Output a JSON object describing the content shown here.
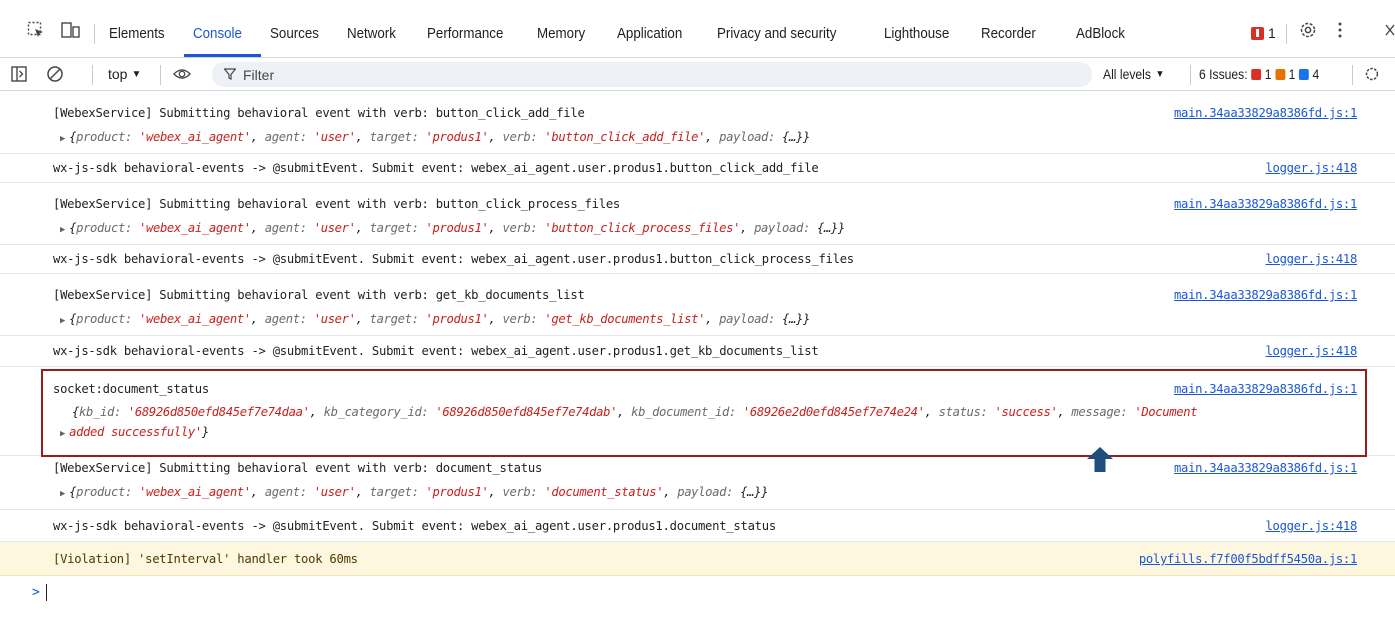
{
  "tabs": [
    {
      "label": "Elements"
    },
    {
      "label": "Console"
    },
    {
      "label": "Sources"
    },
    {
      "label": "Network"
    },
    {
      "label": "Performance"
    },
    {
      "label": "Memory"
    },
    {
      "label": "Application"
    },
    {
      "label": "Privacy and security"
    },
    {
      "label": "Lighthouse"
    },
    {
      "label": "Recorder"
    },
    {
      "label": "AdBlock"
    }
  ],
  "active_tab": "Console",
  "error_count": "1",
  "toolbar": {
    "context": "top",
    "filter_placeholder": "Filter",
    "levels": "All levels",
    "issues_label": "6 Issues:",
    "issues_errors": "1",
    "issues_warnings": "1",
    "issues_info": "4"
  },
  "messages": [
    {
      "text": "[WebexService] Submitting behavioral event with verb: button_click_add_file",
      "source": "main.34aa33829a8386fd.js:1",
      "object": {
        "product": "webex_ai_agent",
        "agent": "user",
        "target": "produs1",
        "verb": "button_click_add_file",
        "payload_text": "{…}"
      }
    },
    {
      "text": "wx-js-sdk behavioral-events ->  @submitEvent. Submit event: webex_ai_agent.user.produs1.button_click_add_file",
      "source": "logger.js:418"
    },
    {
      "text": "[WebexService] Submitting behavioral event with verb: button_click_process_files",
      "source": "main.34aa33829a8386fd.js:1",
      "object": {
        "product": "webex_ai_agent",
        "agent": "user",
        "target": "produs1",
        "verb": "button_click_process_files",
        "payload_text": "{…}"
      }
    },
    {
      "text": "wx-js-sdk behavioral-events ->  @submitEvent. Submit event: webex_ai_agent.user.produs1.button_click_process_files",
      "source": "logger.js:418"
    },
    {
      "text": "[WebexService] Submitting behavioral event with verb: get_kb_documents_list",
      "source": "main.34aa33829a8386fd.js:1",
      "object": {
        "product": "webex_ai_agent",
        "agent": "user",
        "target": "produs1",
        "verb": "get_kb_documents_list",
        "payload_text": "{…}"
      }
    },
    {
      "text": "wx-js-sdk behavioral-events ->  @submitEvent. Submit event: webex_ai_agent.user.produs1.get_kb_documents_list",
      "source": "logger.js:418"
    },
    {
      "text": "socket:document_status",
      "source": "main.34aa33829a8386fd.js:1",
      "status_object": {
        "kb_id": "68926d850efd845ef7e74daa",
        "kb_category_id": "68926d850efd845ef7e74dab",
        "kb_document_id": "68926e2d0efd845ef7e74e24",
        "status": "success",
        "message_part1": "Document",
        "message_part2": "added successfully"
      }
    },
    {
      "text": "[WebexService] Submitting behavioral event with verb: document_status",
      "source": "main.34aa33829a8386fd.js:1",
      "object": {
        "product": "webex_ai_agent",
        "agent": "user",
        "target": "produs1",
        "verb": "document_status",
        "payload_text": "{…}"
      }
    },
    {
      "text": "wx-js-sdk behavioral-events ->  @submitEvent. Submit event: webex_ai_agent.user.produs1.document_status",
      "source": "logger.js:418"
    },
    {
      "text": "[Violation] 'setInterval' handler took 60ms",
      "source": "polyfills.f7f00f5bdff5450a.js:1"
    }
  ],
  "prompt_symbol": ">",
  "colors": {
    "accent": "#1a57d6",
    "error": "#d93025",
    "string": "#c5221f",
    "highlight_border": "#9b1c1c",
    "arrow": "#1e4f7a",
    "violation_bg": "#fef7e0"
  }
}
